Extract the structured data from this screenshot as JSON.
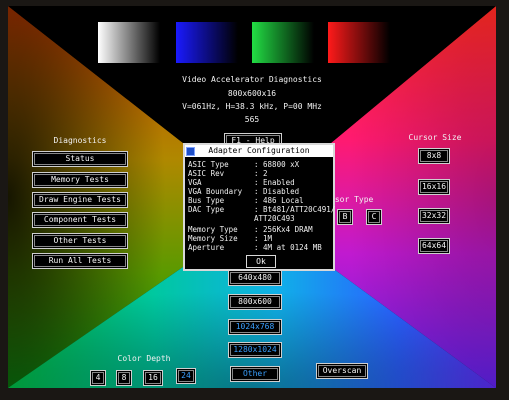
{
  "ramps": [
    {
      "name": "white-ramp",
      "from": "#ffffff",
      "to": "#000000"
    },
    {
      "name": "blue-ramp",
      "from": "#1a1aff",
      "to": "#000000"
    },
    {
      "name": "green-ramp",
      "from": "#22dd44",
      "to": "#000000"
    },
    {
      "name": "red-ramp",
      "from": "#ff1a1a",
      "to": "#000000"
    }
  ],
  "header": {
    "title": "Video Accelerator Diagnostics",
    "resolution": "800x600x16",
    "timing": "V=061Hz, H=38.3 kHz, P=00 MHz",
    "chip": "565"
  },
  "help_button": "F1 - Help",
  "diagnostics": {
    "heading": "Diagnostics",
    "buttons": [
      "Status",
      "Memory Tests",
      "Draw Engine Tests",
      "Component Tests",
      "Other Tests",
      "Run All Tests"
    ]
  },
  "cursor_size": {
    "heading": "Cursor Size",
    "buttons": [
      "8x8",
      "16x16",
      "32x32",
      "64x64"
    ]
  },
  "cursor_type": {
    "heading": "rsor Type",
    "buttons": [
      "B",
      "C"
    ]
  },
  "resolutions": [
    "640x480",
    "800x600",
    "1024x768",
    "1280x1024"
  ],
  "other_button": "Other",
  "overscan_button": "Overscan",
  "color_depth": {
    "heading": "Color Depth",
    "buttons": [
      "4",
      "8",
      "16",
      "24"
    ]
  },
  "dialog": {
    "title": "Adapter Configuration",
    "rows": [
      {
        "k": "ASIC Type",
        "v": ": 68800 xX"
      },
      {
        "k": "ASIC Rev",
        "v": ": 2"
      },
      {
        "k": "VGA",
        "v": ": Enabled"
      },
      {
        "k": "VGA Boundary",
        "v": ": Disabled"
      },
      {
        "k": "Bus Type",
        "v": ": 486 Local"
      },
      {
        "k": "DAC Type",
        "v": ": Bt481/ATT20C491/"
      },
      {
        "k": "",
        "v": "  ATT20C493"
      },
      {
        "k": "Memory Type",
        "v": ": 256Kx4 DRAM"
      },
      {
        "k": "Memory Size",
        "v": ": 1M"
      },
      {
        "k": "Aperture",
        "v": ": 4M at 0124 MB"
      }
    ],
    "ok": "Ok"
  }
}
